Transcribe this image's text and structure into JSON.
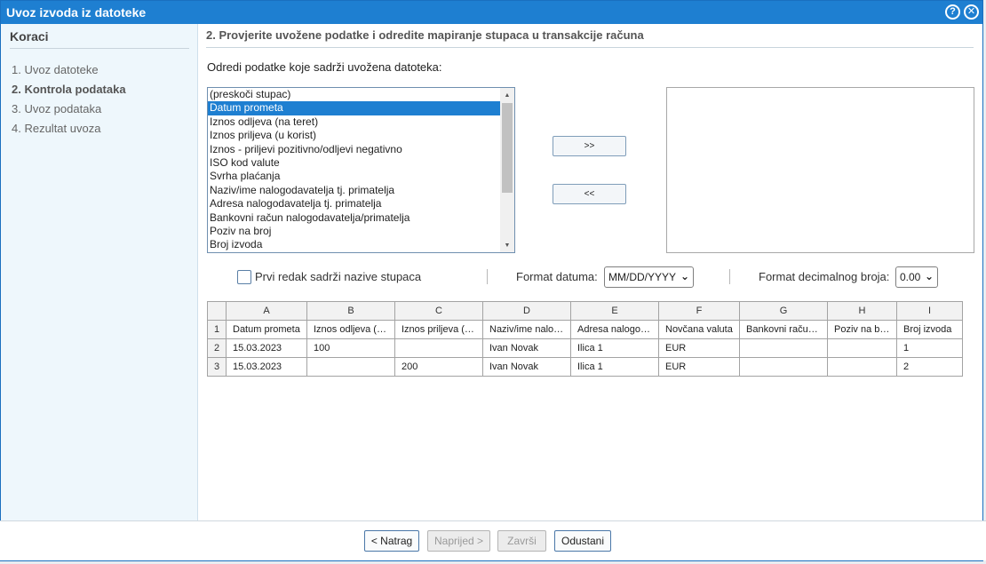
{
  "window": {
    "title": "Uvoz izvoda iz datoteke",
    "help_icon": "?",
    "close_icon": "✕"
  },
  "sidebar": {
    "title": "Koraci",
    "steps": [
      {
        "label": "1. Uvoz datoteke",
        "active": false
      },
      {
        "label": "2. Kontrola podataka",
        "active": true
      },
      {
        "label": "3. Uvoz podataka",
        "active": false
      },
      {
        "label": "4. Rezultat uvoza",
        "active": false
      }
    ]
  },
  "main": {
    "title": "2. Provjerite uvožene podatke i odredite mapiranje stupaca u transakcije računa",
    "instruction": "Odredi podatke koje sadrži uvožena datoteka:",
    "fields": [
      "(preskoči stupac)",
      "Datum prometa",
      "Iznos odljeva (na teret)",
      "Iznos priljeva (u korist)",
      "Iznos - priljevi pozitivno/odljevi negativno",
      "ISO kod valute",
      "Svrha plaćanja",
      "Naziv/ime nalogodavatelja tj. primatelja",
      "Adresa nalogodavatelja tj. primatelja",
      "Bankovni račun nalogodavatelja/primatelja",
      "Poziv na broj",
      "Broj izvoda"
    ],
    "selected_field": "Datum prometa",
    "add_button": ">>",
    "remove_button": "<<",
    "options": {
      "first_row_label": "Prvi redak sadrži nazive stupaca",
      "first_row_checked": false,
      "date_format_label": "Format datuma:",
      "date_format_value": "MM/DD/YYYY",
      "decimal_format_label": "Format decimalnog broja:",
      "decimal_format_value": "0.00"
    },
    "preview": {
      "column_letters": [
        "A",
        "B",
        "C",
        "D",
        "E",
        "F",
        "G",
        "H",
        "I"
      ],
      "rows": [
        {
          "num": "1",
          "cells": [
            "Datum prometa",
            "Iznos odljeva (na teret)",
            "Iznos priljeva (u korist)",
            "Naziv/ime nalogodavatelja",
            "Adresa nalogodavatelja",
            "Novčana valuta",
            "Bankovni račun nalogodavatelja",
            "Poziv na broj",
            "Broj izvoda"
          ]
        },
        {
          "num": "2",
          "cells": [
            "15.03.2023",
            "100",
            "",
            "Ivan Novak",
            "Ilica 1",
            "EUR",
            "",
            "",
            "1"
          ]
        },
        {
          "num": "3",
          "cells": [
            "15.03.2023",
            "",
            "200",
            "Ivan Novak",
            "Ilica 1",
            "EUR",
            "",
            "",
            "2"
          ]
        }
      ]
    }
  },
  "footer": {
    "back": "< Natrag",
    "next": "Naprijed >",
    "finish": "Završi",
    "cancel": "Odustani"
  },
  "colors": {
    "accent": "#1e7fd1",
    "sidebar_bg": "#eef7fc"
  }
}
